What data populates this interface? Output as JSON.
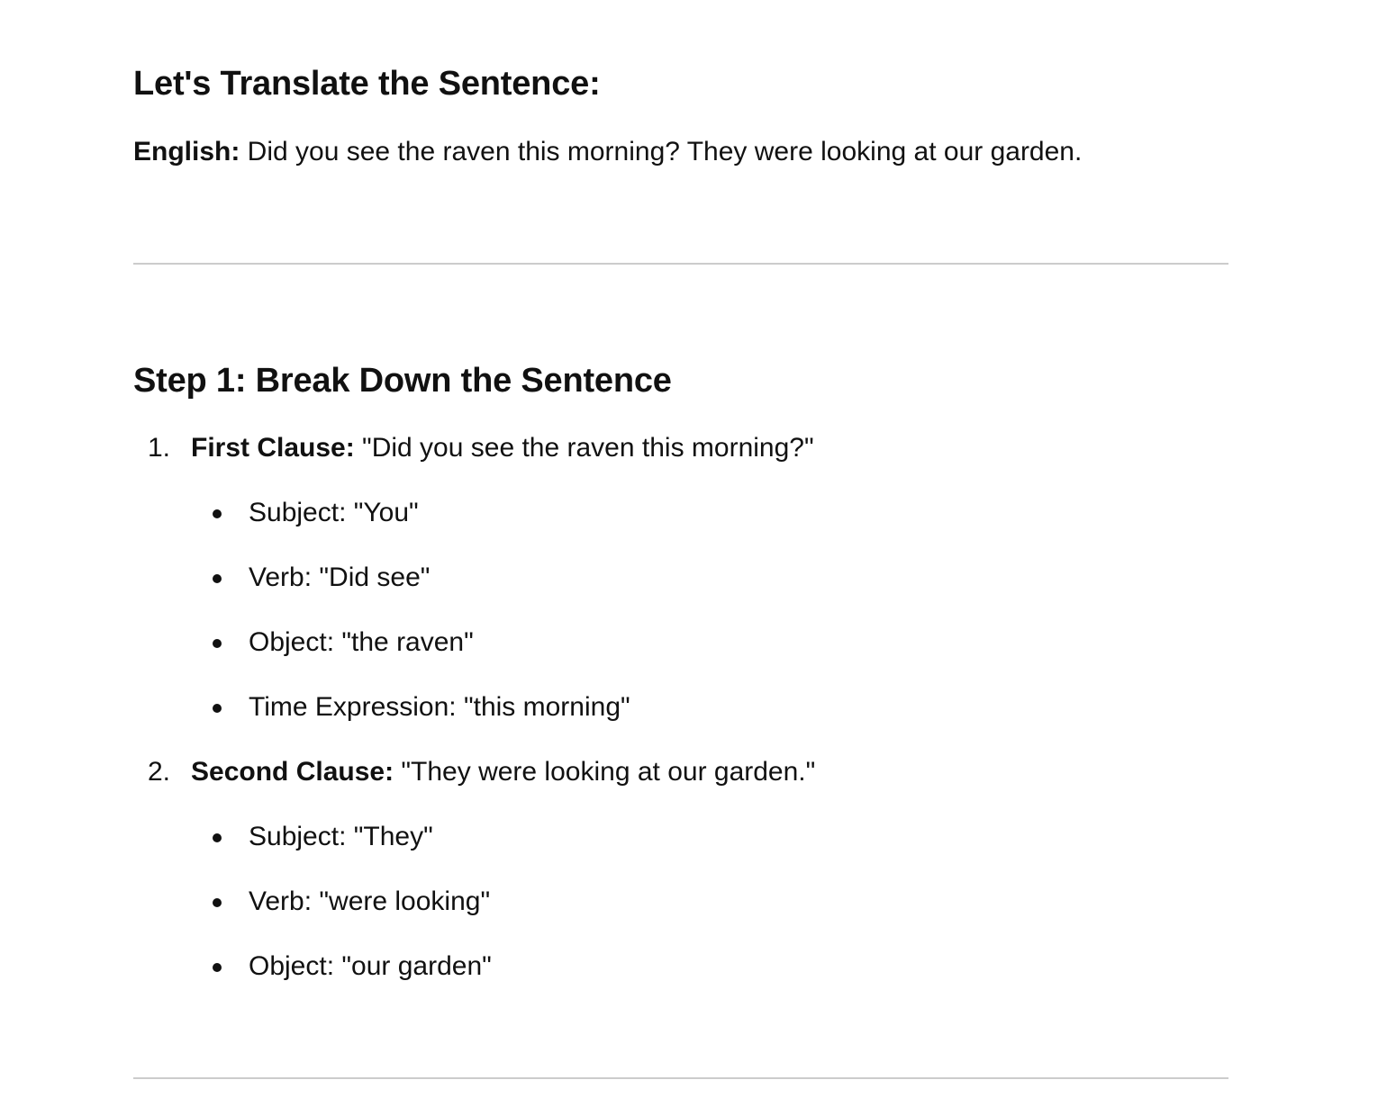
{
  "header": {
    "title": "Let's Translate the Sentence:",
    "english_label": "English:",
    "english_text": " Did you see the raven this morning? They were looking at our garden."
  },
  "step1": {
    "title": "Step 1: Break Down the Sentence",
    "clauses": [
      {
        "number": "1.",
        "label": "First Clause:",
        "text": " \"Did you see the raven this morning?\"",
        "parts": [
          "Subject: \"You\"",
          "Verb: \"Did see\"",
          "Object: \"the raven\"",
          "Time Expression: \"this morning\""
        ]
      },
      {
        "number": "2.",
        "label": "Second Clause:",
        "text": " \"They were looking at our garden.\"",
        "parts": [
          "Subject: \"They\"",
          "Verb: \"were looking\"",
          "Object: \"our garden\""
        ]
      }
    ]
  }
}
